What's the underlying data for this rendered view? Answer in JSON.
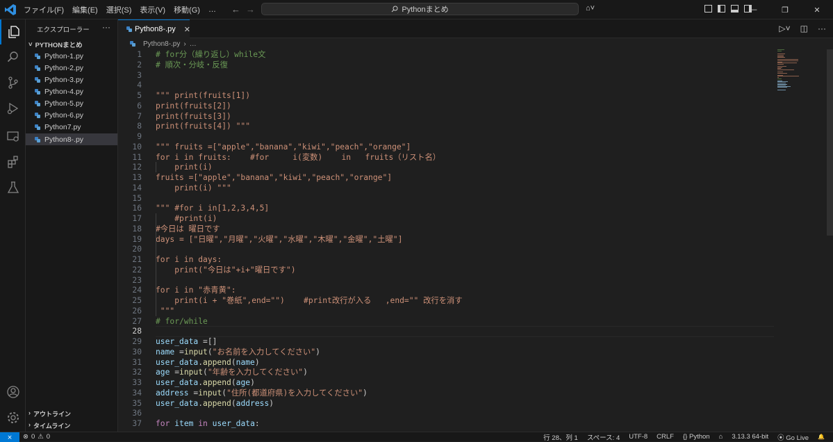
{
  "titlebar": {
    "menus": [
      "ファイル(F)",
      "編集(E)",
      "選択(S)",
      "表示(V)",
      "移動(G)",
      "…"
    ],
    "back": "←",
    "forward": "→",
    "search_text": "Pythonまとめ",
    "copilot": "⌂˅"
  },
  "window_controls": {
    "minimize": "—",
    "restore": "❐",
    "close": "✕"
  },
  "sidebar": {
    "title": "エクスプローラー",
    "more": "···",
    "folder": "PYTHONまとめ",
    "files": [
      "Python-1.py",
      "Python-2.py",
      "Python-3.py",
      "Python-4.py",
      "Python-5.py",
      "Python-6.py",
      "Python7.py",
      "Python8-.py"
    ],
    "selected_file": "Python8-.py",
    "outline": "アウトライン",
    "timeline": "タイムライン"
  },
  "tab": {
    "label": "Python8-.py",
    "close": "✕"
  },
  "tab_actions": {
    "run": "▷˅",
    "split": "◫",
    "more": "···"
  },
  "breadcrumb": {
    "file": "Python8-.py",
    "rest": "…"
  },
  "editor": {
    "current_line": 28,
    "lines": [
      {
        "n": 1,
        "t": "# for分（繰り返し）while文"
      },
      {
        "n": 2,
        "t": "# 順次・分岐・反復"
      },
      {
        "n": 3,
        "t": ""
      },
      {
        "n": 4,
        "t": ""
      },
      {
        "n": 5,
        "t": "\"\"\" print(fruits[1])"
      },
      {
        "n": 6,
        "t": "print(fruits[2])"
      },
      {
        "n": 7,
        "t": "print(fruits[3])"
      },
      {
        "n": 8,
        "t": "print(fruits[4]) \"\"\""
      },
      {
        "n": 9,
        "t": ""
      },
      {
        "n": 10,
        "t": "\"\"\" fruits =[\"apple\",\"banana\",\"kiwi\",\"peach\",\"orange\"]"
      },
      {
        "n": 11,
        "t": "for i in fruits:    #for     i(変数)    in   fruits（リスト名）"
      },
      {
        "n": 12,
        "t": "    print(i)"
      },
      {
        "n": 13,
        "t": "fruits =[\"apple\",\"banana\",\"kiwi\",\"peach\",\"orange\"]"
      },
      {
        "n": 14,
        "t": "    print(i) \"\"\""
      },
      {
        "n": 15,
        "t": ""
      },
      {
        "n": 16,
        "t": "\"\"\" #for i in[1,2,3,4,5]"
      },
      {
        "n": 17,
        "t": "    #print(i)"
      },
      {
        "n": 18,
        "t": "#今日は 曜日です"
      },
      {
        "n": 19,
        "t": "days = [\"日曜\",\"月曜\",\"火曜\",\"水曜\",\"木曜\",\"金曜\",\"土曜\"]"
      },
      {
        "n": 20,
        "t": ""
      },
      {
        "n": 21,
        "t": "for i in days:"
      },
      {
        "n": 22,
        "t": "    print(\"今日は\"+i+\"曜日です\")"
      },
      {
        "n": 23,
        "t": ""
      },
      {
        "n": 24,
        "t": "for i in \"赤青黄\":"
      },
      {
        "n": 25,
        "t": "    print(i + \"巻紙\",end=\"\")    #print改行が入る   ,end=\"\" 改行を消す"
      },
      {
        "n": 26,
        "t": " \"\"\""
      },
      {
        "n": 27,
        "t": "# for/while"
      },
      {
        "n": 28,
        "t": ""
      },
      {
        "n": 29,
        "t": "user_data =[]"
      },
      {
        "n": 30,
        "t": "name =input(\"お名前を入力してください\")"
      },
      {
        "n": 31,
        "t": "user_data.append(name)"
      },
      {
        "n": 32,
        "t": "age =input(\"年齢を入力してください\")"
      },
      {
        "n": 33,
        "t": "user_data.append(age)"
      },
      {
        "n": 34,
        "t": "address =input(\"住所(都道府県)を入力してください\")"
      },
      {
        "n": 35,
        "t": "user_data.append(address)"
      },
      {
        "n": 36,
        "t": ""
      },
      {
        "n": 37,
        "t": "for item in user_data:"
      }
    ]
  },
  "statusbar": {
    "remote": "⨯",
    "errors": "0",
    "warnings": "0",
    "position": "行 28、列 1",
    "spaces": "スペース: 4",
    "encoding": "UTF-8",
    "eol": "CRLF",
    "language": "Python",
    "interpreter": "3.13.3 64-bit",
    "golive": "Go Live",
    "bell": "🔔"
  },
  "colors": {
    "accent": "#0078d4",
    "comment": "#6a9955",
    "string": "#ce9178",
    "variable": "#9cdcfe",
    "keyword": "#c586c0",
    "function": "#dcdcaa"
  }
}
